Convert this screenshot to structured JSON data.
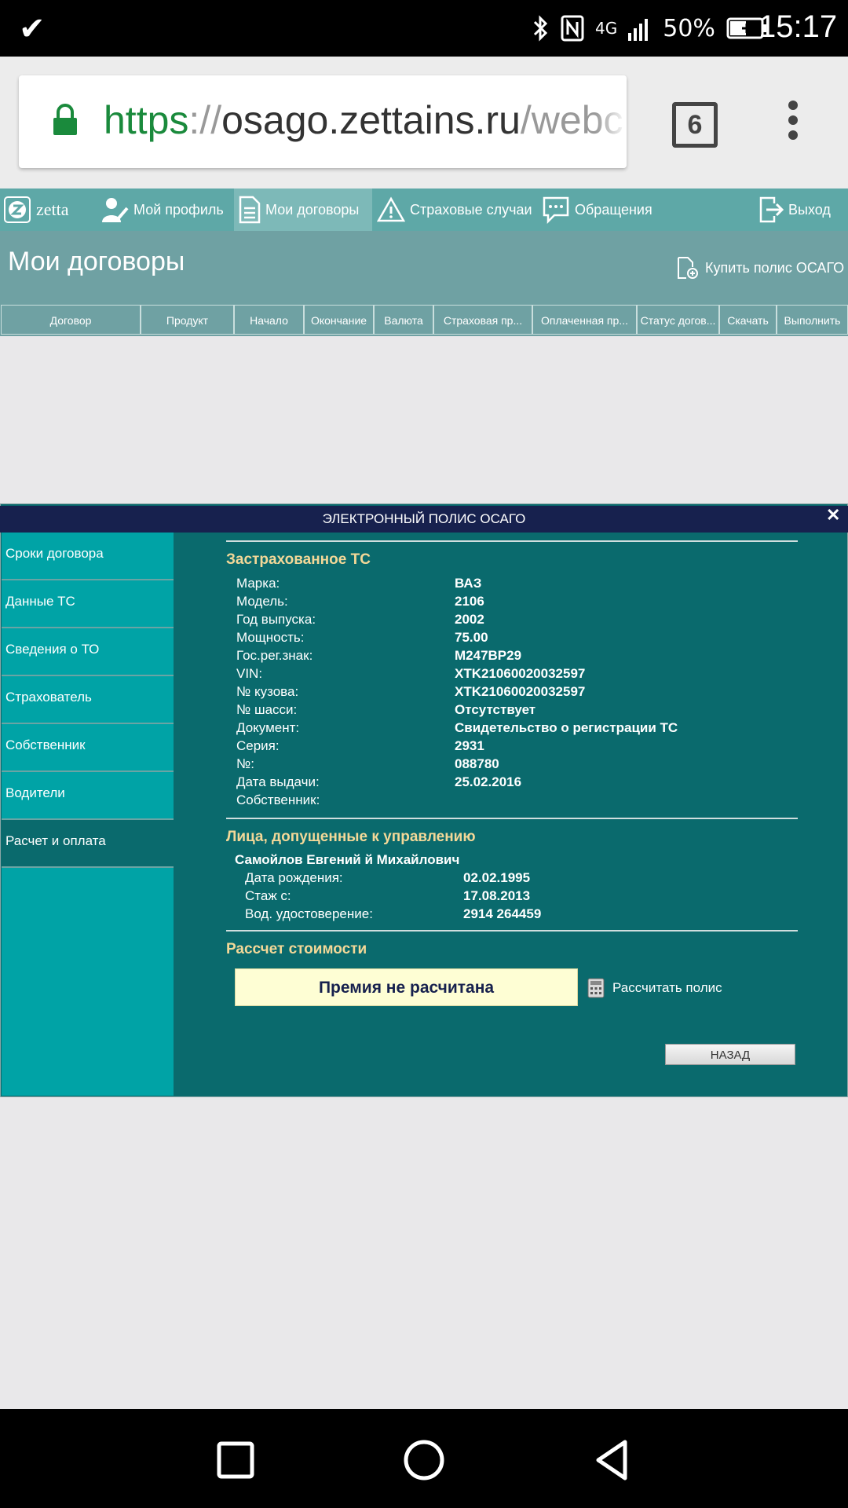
{
  "status_bar": {
    "signal_text": "4G",
    "battery": "50%",
    "time": "15:17"
  },
  "browser": {
    "url_scheme": "https",
    "url_sep": "://",
    "url_host": "osago.zettains.ru",
    "url_path": "/webc",
    "tab_count": "6"
  },
  "site_nav": {
    "logo": "zetta",
    "items": [
      {
        "label": "Мой профиль",
        "icon": "user-edit-icon"
      },
      {
        "label": "Мои договоры",
        "icon": "document-icon"
      },
      {
        "label": "Страховые случаи",
        "icon": "warning-icon"
      },
      {
        "label": "Обращения",
        "icon": "chat-icon"
      }
    ],
    "logout": "Выход"
  },
  "page": {
    "title": "Мои договоры",
    "buy_button": "Купить полис ОСАГО"
  },
  "grid": {
    "columns": [
      "Договор",
      "Продукт",
      "Начало",
      "Окончание",
      "Валюта",
      "Страховая пр...",
      "Оплаченная пр...",
      "Статус догов...",
      "Скачать",
      "Выполнить"
    ]
  },
  "modal": {
    "title": "ЭЛЕКТРОННЫЙ ПОЛИС ОСАГО",
    "close": "✕",
    "sidebar": [
      "Сроки договора",
      "Данные ТС",
      "Сведения о ТО",
      "Страхователь",
      "Собственник",
      "Водители",
      "Расчет и оплата"
    ],
    "vehicle": {
      "title": "Застрахованное ТС",
      "rows": [
        {
          "label": "Марка:",
          "value": "ВАЗ"
        },
        {
          "label": "Модель:",
          "value": "2106"
        },
        {
          "label": "Год выпуска:",
          "value": "2002"
        },
        {
          "label": "Мощность:",
          "value": "75.00"
        },
        {
          "label": "Гос.рег.знак:",
          "value": "М247ВР29"
        },
        {
          "label": "VIN:",
          "value": "XTK21060020032597"
        },
        {
          "label": "№ кузова:",
          "value": "XTK21060020032597"
        },
        {
          "label": "№ шасси:",
          "value": "Отсутствует"
        },
        {
          "label": "Документ:",
          "value": "Свидетельство о регистрации ТС"
        },
        {
          "label": "Серия:",
          "value": "2931"
        },
        {
          "label": "№:",
          "value": "088780"
        },
        {
          "label": "Дата выдачи:",
          "value": "25.02.2016"
        },
        {
          "label": "Собственник:",
          "value": ""
        }
      ]
    },
    "drivers": {
      "title": "Лица, допущенные к управлению",
      "name": "Самойлов Евгений й Михайлович",
      "rows": [
        {
          "label": "Дата рождения:",
          "value": "02.02.1995"
        },
        {
          "label": "Стаж с:",
          "value": "17.08.2013"
        },
        {
          "label": "Вод. удостоверение:",
          "value": "2914 264459"
        }
      ]
    },
    "cost": {
      "title": "Рассчет стоимости",
      "premium": "Премия не расчитана",
      "calculate": "Рассчитать полис"
    },
    "back_button": "НАЗАД"
  }
}
